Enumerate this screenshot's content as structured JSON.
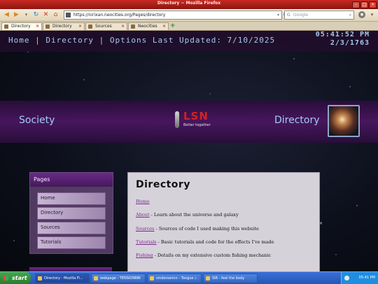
{
  "browser": {
    "window_title": "Directory ~ Mozilla Firefox",
    "url": "https://nirixan.neocities.org/Pages/directory",
    "search_placeholder": "Google",
    "tabs": [
      {
        "label": "Directory",
        "active": true
      },
      {
        "label": "Directory",
        "active": false
      },
      {
        "label": "Sources",
        "active": false
      },
      {
        "label": "Neocities",
        "active": false
      }
    ],
    "new_tab_label": "+"
  },
  "site": {
    "nav": {
      "home": "Home",
      "sep1": "|",
      "directory": "Directory",
      "sep2": "|",
      "options": "Options",
      "last_updated": "Last Updated: 7/10/2025"
    },
    "clock_time": "05:41:52 PM",
    "clock_date": "2/3/1763",
    "banner_left": "Society",
    "banner_right": "Directory",
    "logo_text": "LSN",
    "logo_tagline": "Better together",
    "sidebar": {
      "title": "Pages",
      "items": [
        "Home",
        "Directory",
        "Sources",
        "Tutorials"
      ]
    },
    "main": {
      "heading": "Directory",
      "entries": [
        {
          "link": "Home",
          "desc": ""
        },
        {
          "link": "About",
          "desc": " - Learn about the universe and galaxy"
        },
        {
          "link": "Sources",
          "desc": " - Sources of code I used making this website"
        },
        {
          "link": "Tutorials",
          "desc": " - Basic tutorials and code for the effects I've made"
        },
        {
          "link": "Fishing",
          "desc": " - Details on my extensive custom fishing mechanic"
        }
      ]
    }
  },
  "taskbar": {
    "start_label": "start",
    "tasks": [
      "Directory - Mozilla Fi...",
      "webpage - TENSIONNN",
      "sindersonnn - Tongue /...",
      "SIR - feel the body"
    ],
    "tray_time": "05:41 PM"
  },
  "colors": {
    "accent_text": "#9fcdf2",
    "logo_red": "#d42222",
    "panel_purple": "#6a2a86"
  }
}
